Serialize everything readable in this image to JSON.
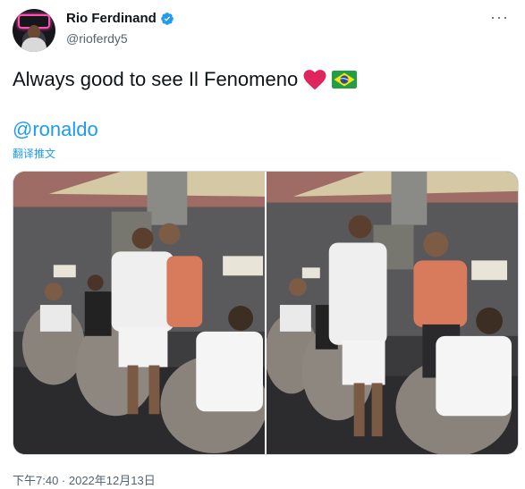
{
  "author": {
    "name": "Rio Ferdinand",
    "handle": "@rioferdy5",
    "verified_color": "#1d9bf0"
  },
  "tweet": {
    "text": "Always good to see Il Fenomeno",
    "emojis": [
      "red-heart",
      "brazil-flag"
    ],
    "mention": "@ronaldo",
    "translate_label": "翻译推文",
    "timestamp": "下午7:40 · 2022年12月13日"
  },
  "media": {
    "photos": [
      {
        "description_icon": "photo-lounge-hug"
      },
      {
        "description_icon": "photo-lounge-standing"
      }
    ]
  },
  "colors": {
    "accent": "#1d9bf0",
    "secondary_text": "#536471",
    "heart": "#e0245e"
  }
}
